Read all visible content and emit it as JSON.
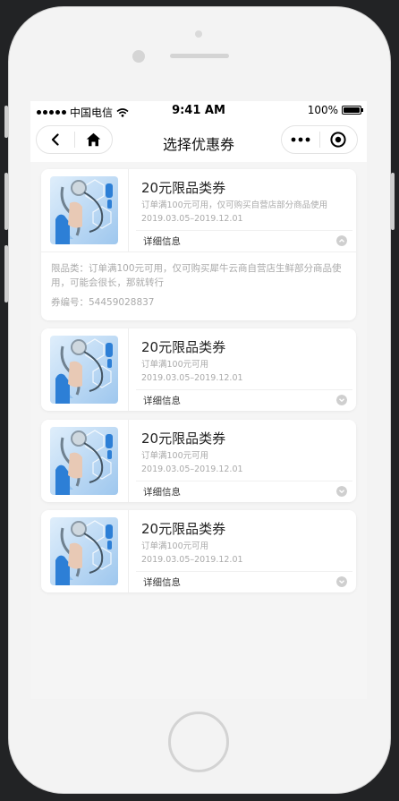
{
  "status_bar": {
    "carrier": "中国电信",
    "time": "9:41 AM",
    "battery": "100%"
  },
  "nav": {
    "title": "选择优惠券"
  },
  "coupons": [
    {
      "title": "20元限品类券",
      "desc": "订单满100元可用，仅可购买自营店部分商品使用",
      "date": "2019.03.05–2019.12.01",
      "more": "详细信息",
      "expanded": true,
      "detail": "限品类：订单满100元可用，仅可购买犀牛云商自营店生鲜部分商品使用，可能会很长，那就转行",
      "code": "券编号：54459028837"
    },
    {
      "title": "20元限品类券",
      "desc": "订单满100元可用",
      "date": "2019.03.05–2019.12.01",
      "more": "详细信息",
      "expanded": false
    },
    {
      "title": "20元限品类券",
      "desc": "订单满100元可用",
      "date": "2019.03.05–2019.12.01",
      "more": "详细信息",
      "expanded": false
    },
    {
      "title": "20元限品类券",
      "desc": "订单满100元可用",
      "date": "2019.03.05–2019.12.01",
      "more": "详细信息",
      "expanded": false
    }
  ]
}
